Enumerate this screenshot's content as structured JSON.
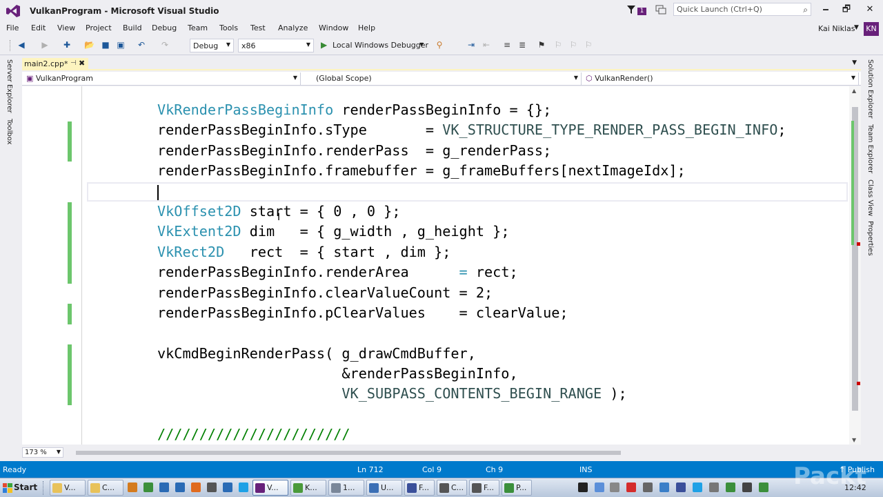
{
  "window": {
    "title": "VulkanProgram - Microsoft Visual Studio",
    "notification_count": "1",
    "quick_launch_placeholder": "Quick Launch (Ctrl+Q)",
    "minimize": "🗕",
    "maximize": "🗗",
    "close": "✕"
  },
  "menu": {
    "items": [
      "File",
      "Edit",
      "View",
      "Project",
      "Build",
      "Debug",
      "Team",
      "Tools",
      "Test",
      "Analyze",
      "Window",
      "Help"
    ],
    "user": "Kai Niklas",
    "avatar_initials": "KN"
  },
  "toolbar": {
    "configuration": "Debug",
    "platform": "x86",
    "debugger": "Local Windows Debugger"
  },
  "side_tabs_left": [
    "Server Explorer",
    "Toolbox"
  ],
  "side_tabs_right": [
    "Solution Explorer",
    "Team Explorer",
    "Class View",
    "Properties"
  ],
  "document": {
    "tab": "main2.cpp*",
    "nav_project": "VulkanProgram",
    "nav_scope": "(Global Scope)",
    "nav_function": "VulkanRender()",
    "zoom": "173 %"
  },
  "code_lines": [
    [
      {
        "c": "t",
        "s": "VkRenderPassBeginInfo"
      },
      {
        "c": "",
        "s": " renderPassBeginInfo = {};"
      }
    ],
    [
      {
        "c": "",
        "s": "renderPassBeginInfo.sType       = "
      },
      {
        "c": "e",
        "s": "VK_STRUCTURE_TYPE_RENDER_PASS_BEGIN_INFO"
      },
      {
        "c": "",
        "s": ";"
      }
    ],
    [
      {
        "c": "",
        "s": "renderPassBeginInfo.renderPass  = g_renderPass;"
      }
    ],
    [
      {
        "c": "",
        "s": "renderPassBeginInfo.framebuffer = g_frameBuffers[nextImageIdx];"
      }
    ],
    [
      {
        "c": "",
        "s": ""
      }
    ],
    [
      {
        "c": "t",
        "s": "VkOffset2D"
      },
      {
        "c": "",
        "s": " start = { 0 , 0 };"
      }
    ],
    [
      {
        "c": "t",
        "s": "VkExtent2D"
      },
      {
        "c": "",
        "s": " dim   = { g_width , g_height };"
      }
    ],
    [
      {
        "c": "t",
        "s": "VkRect2D"
      },
      {
        "c": "",
        "s": "   rect  = { start , dim };"
      }
    ],
    [
      {
        "c": "",
        "s": "renderPassBeginInfo.renderArea      "
      },
      {
        "c": "t",
        "s": "="
      },
      {
        "c": "",
        "s": " rect;"
      }
    ],
    [
      {
        "c": "",
        "s": "renderPassBeginInfo.clearValueCount = 2;"
      }
    ],
    [
      {
        "c": "",
        "s": "renderPassBeginInfo.pClearValues    = clearValue;"
      }
    ],
    [
      {
        "c": "",
        "s": ""
      }
    ],
    [
      {
        "c": "",
        "s": "vkCmdBeginRenderPass( g_drawCmdBuffer,"
      }
    ],
    [
      {
        "c": "",
        "s": "                      &renderPassBeginInfo,"
      }
    ],
    [
      {
        "c": "",
        "s": "                      "
      },
      {
        "c": "e",
        "s": "VK_SUBPASS_CONTENTS_BEGIN_RANGE"
      },
      {
        "c": "",
        "s": " );"
      }
    ],
    [
      {
        "c": "",
        "s": ""
      }
    ],
    [
      {
        "c": "c",
        "s": "///////////////////////"
      }
    ]
  ],
  "status": {
    "ready": "Ready",
    "line": "Ln 712",
    "col": "Col 9",
    "ch": "Ch 9",
    "mode": "INS",
    "publish": "↑ Publish"
  },
  "taskbar": {
    "start": "Start",
    "buttons": [
      {
        "label": "V...",
        "color": "#e8c25a"
      },
      {
        "label": "C...",
        "color": "#e8c25a"
      },
      {
        "label": "",
        "color": "#d47b1e"
      },
      {
        "label": "",
        "color": "#3b8f3b"
      },
      {
        "label": "",
        "color": "#2a6bb5"
      },
      {
        "label": "",
        "color": "#2a6bb5"
      },
      {
        "label": "",
        "color": "#e06b1f"
      },
      {
        "label": "",
        "color": "#555555"
      },
      {
        "label": "",
        "color": "#2a6bb5"
      },
      {
        "label": "",
        "color": "#1ea1e6"
      },
      {
        "label": "V...",
        "color": "#68217a"
      },
      {
        "label": "K...",
        "color": "#4a9a3a"
      },
      {
        "label": "1...",
        "color": "#7a8799"
      },
      {
        "label": "U...",
        "color": "#3b6fb5"
      },
      {
        "label": "F...",
        "color": "#3a4f9a"
      },
      {
        "label": "C...",
        "color": "#555555"
      },
      {
        "label": "F...",
        "color": "#555555"
      },
      {
        "label": "P...",
        "color": "#3b8f3b"
      }
    ],
    "clock": "12:42"
  },
  "colors": {
    "accent": "#007acc",
    "vs_purple": "#68217a",
    "type_color": "#2b91af",
    "change_bar": "#6cc66c"
  }
}
